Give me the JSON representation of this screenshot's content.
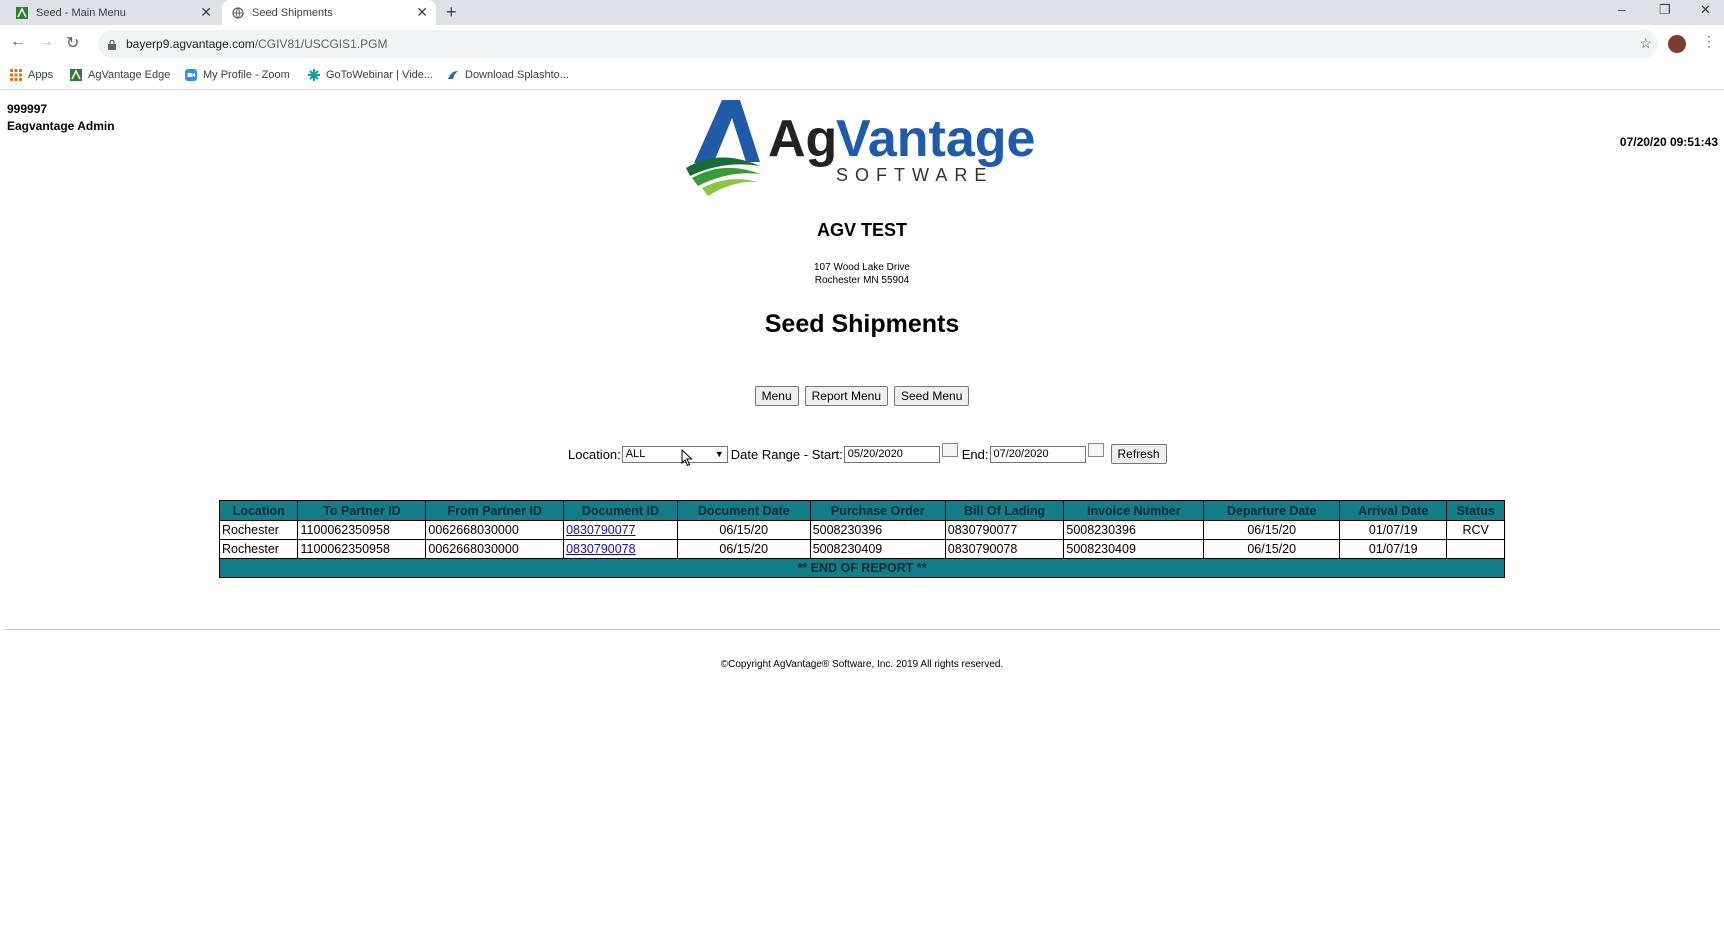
{
  "browser": {
    "tabs": [
      {
        "title": "Seed - Main Menu"
      },
      {
        "title": "Seed Shipments"
      }
    ],
    "url_host": "bayerp9.agvantage.com",
    "url_path": "/CGIV81/USCGIS1.PGM",
    "bookmarks": [
      {
        "label": "Apps"
      },
      {
        "label": "AgVantage Edge"
      },
      {
        "label": "My Profile - Zoom"
      },
      {
        "label": "GoToWebinar | Vide..."
      },
      {
        "label": "Download Splashto..."
      }
    ]
  },
  "user": {
    "id": "999997",
    "name": "Eagvantage Admin"
  },
  "timestamp": "07/20/20 09:51:43",
  "logo": {
    "brand_ag": "Ag",
    "brand_vantage": "Vantage",
    "brand_sub": "SOFTWARE"
  },
  "company": {
    "name": "AGV TEST",
    "address_line1": "107 Wood Lake Drive",
    "address_line2": "Rochester MN 55904"
  },
  "page_title": "Seed Shipments",
  "nav_buttons": {
    "menu": "Menu",
    "report_menu": "Report Menu",
    "seed_menu": "Seed Menu"
  },
  "filters": {
    "location_label": "Location:",
    "location_value": "ALL",
    "date_range_start_label": "Date Range - Start:",
    "start_date": "05/20/2020",
    "end_label": "End:",
    "end_date": "07/20/2020",
    "refresh_label": "Refresh"
  },
  "table": {
    "columns": [
      "Location",
      "To Partner ID",
      "From Partner ID",
      "Document ID",
      "Document Date",
      "Purchase Order",
      "Bill Of Lading",
      "Invoice Number",
      "Departure Date",
      "Arrival Date",
      "Status"
    ],
    "rows": [
      [
        "Rochester",
        "1100062350958",
        "0062668030000",
        "0830790077",
        "06/15/20",
        "5008230396",
        "0830790077",
        "5008230396",
        "06/15/20",
        "01/07/19",
        "RCV"
      ],
      [
        "Rochester",
        "1100062350958",
        "0062668030000",
        "0830790078",
        "06/15/20",
        "5008230409",
        "0830790078",
        "5008230409",
        "06/15/20",
        "01/07/19",
        ""
      ]
    ],
    "end_text": "** END OF REPORT **"
  },
  "footer": {
    "copyright": "©Copyright AgVantage® Software, Inc. 2019 All rights reserved."
  },
  "colors": {
    "table_header": "#137d8a",
    "logo_blue": "#1f5ba8",
    "logo_green": "#5cb83a"
  }
}
